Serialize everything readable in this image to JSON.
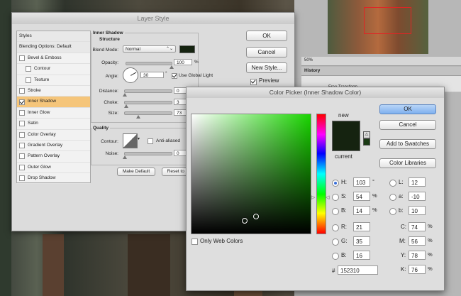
{
  "layer_style": {
    "title": "Layer Style",
    "styles": [
      {
        "label": "Styles",
        "checkbox": false,
        "checked": false,
        "header": true
      },
      {
        "label": "Blending Options: Default",
        "checkbox": false,
        "checked": false,
        "header": true
      },
      {
        "label": "Bevel & Emboss",
        "checkbox": true,
        "checked": false
      },
      {
        "label": "Contour",
        "checkbox": true,
        "checked": false,
        "sub": true
      },
      {
        "label": "Texture",
        "checkbox": true,
        "checked": false,
        "sub": true
      },
      {
        "label": "Stroke",
        "checkbox": true,
        "checked": false
      },
      {
        "label": "Inner Shadow",
        "checkbox": true,
        "checked": true,
        "selected": true
      },
      {
        "label": "Inner Glow",
        "checkbox": true,
        "checked": false
      },
      {
        "label": "Satin",
        "checkbox": true,
        "checked": false
      },
      {
        "label": "Color Overlay",
        "checkbox": true,
        "checked": false
      },
      {
        "label": "Gradient Overlay",
        "checkbox": true,
        "checked": false
      },
      {
        "label": "Pattern Overlay",
        "checkbox": true,
        "checked": false
      },
      {
        "label": "Outer Glow",
        "checkbox": true,
        "checked": false
      },
      {
        "label": "Drop Shadow",
        "checkbox": true,
        "checked": false
      }
    ],
    "section_title": "Inner Shadow",
    "structure_title": "Structure",
    "blend_mode_label": "Blend Mode:",
    "blend_mode_value": "Normal",
    "opacity_label": "Opacity:",
    "opacity_value": "100",
    "opacity_unit": "%",
    "opacity_level": 1.0,
    "angle_label": "Angle:",
    "angle_value": "30",
    "angle_unit": "°",
    "global_light_label": "Use Global Light",
    "distance_label": "Distance:",
    "distance_value": "0",
    "distance_level": 0.0,
    "choke_label": "Choke:",
    "choke_value": "3",
    "choke_level": 0.03,
    "size_label": "Size:",
    "size_value": "73",
    "size_level": 0.29,
    "quality_title": "Quality",
    "contour_label": "Contour:",
    "anti_aliased_label": "Anti-aliased",
    "noise_label": "Noise:",
    "noise_value": "0",
    "noise_level": 0.0,
    "make_default_label": "Make Default",
    "reset_default_label": "Reset to D",
    "ok_label": "OK",
    "cancel_label": "Cancel",
    "new_style_label": "New Style...",
    "preview_label": "Preview",
    "shadow_color": "#152310"
  },
  "panels": {
    "zoom": "50%",
    "history_title": "History",
    "history_items": [
      "Free Transform"
    ]
  },
  "color_picker": {
    "title": "Color Picker (Inner Shadow Color)",
    "ok_label": "OK",
    "cancel_label": "Cancel",
    "add_swatches_label": "Add to Swatches",
    "color_libraries_label": "Color Libraries",
    "new_label": "new",
    "current_label": "current",
    "only_web_colors_label": "Only Web Colors",
    "new_color": "#152310",
    "current_color": "#152310",
    "hue_color": "#19d500",
    "h_label": "H:",
    "h_value": "103",
    "h_unit": "°",
    "s_label": "S:",
    "s_value": "54",
    "s_unit": "%",
    "b_label": "B:",
    "b_value": "14",
    "b_unit": "%",
    "r_label": "R:",
    "r_value": "21",
    "g_label": "G:",
    "g_value": "35",
    "bb_label": "B:",
    "bb_value": "16",
    "l_label": "L:",
    "l_value": "12",
    "a_label": "a:",
    "a_value": "-10",
    "lb_label": "b:",
    "lb_value": "10",
    "c_label": "C:",
    "c_value": "74",
    "m_label": "M:",
    "m_value": "56",
    "y_label": "Y:",
    "y_value": "78",
    "k_label": "K:",
    "k_value": "76",
    "cmyk_unit": "%",
    "hex_label": "#",
    "hex_value": "152310"
  }
}
